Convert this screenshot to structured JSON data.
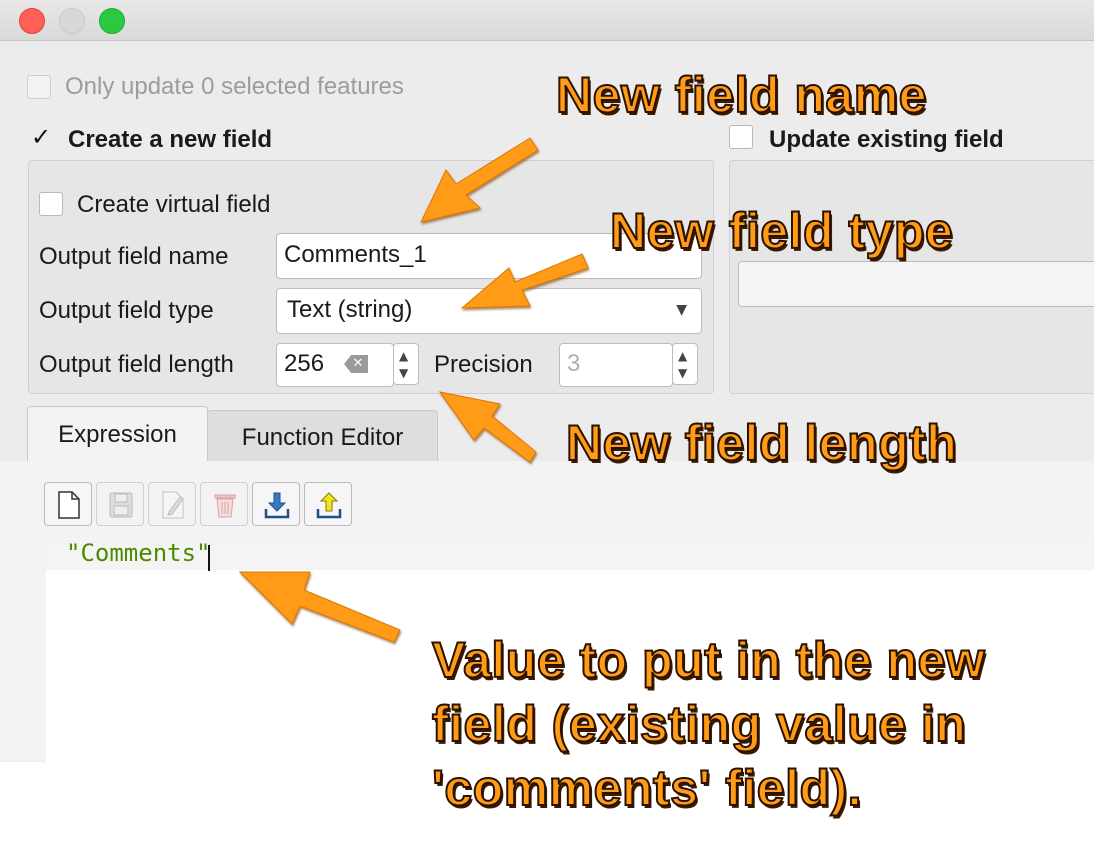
{
  "window": {
    "traffic_lights": [
      "close",
      "minimize",
      "zoom"
    ]
  },
  "only_update": {
    "label": "Only update 0 selected features",
    "checked": false,
    "enabled": false
  },
  "create_new_field": {
    "label": "Create a new field",
    "checked": true,
    "virtual": {
      "label": "Create virtual field",
      "checked": false
    },
    "name": {
      "label": "Output field name",
      "value": "Comments_1"
    },
    "type": {
      "label": "Output field type",
      "value": "Text (string)"
    },
    "length": {
      "label": "Output field length",
      "value": "256"
    },
    "precision": {
      "label": "Precision",
      "value": "3"
    }
  },
  "update_existing": {
    "label": "Update existing field",
    "checked": false
  },
  "tabs": [
    {
      "label": "Expression",
      "active": true
    },
    {
      "label": "Function Editor",
      "active": false
    }
  ],
  "toolbar": {
    "buttons": [
      "new-file-icon",
      "save-icon",
      "edit-icon",
      "delete-icon",
      "import-icon",
      "export-icon"
    ]
  },
  "editor": {
    "code": "\"Comments\""
  },
  "annotations": {
    "field_name": "New field name",
    "field_type": "New field type",
    "field_length": "New field length",
    "value_note": "Value to put in the new field (existing value in 'comments' field)."
  },
  "colors": {
    "annotation": "#ff9b16",
    "code_string": "#4d8a00",
    "close": "#fe5f57",
    "zoom": "#2bc840"
  }
}
